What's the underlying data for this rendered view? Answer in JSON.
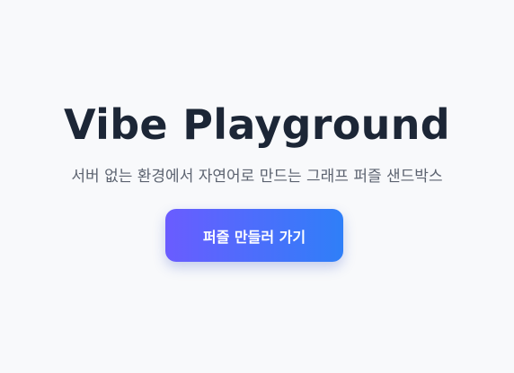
{
  "hero": {
    "title": "Vibe Playground",
    "subtitle": "서버 없는 환경에서 자연어로 만드는 그래프 퍼즐 샌드박스",
    "cta_label": "퍼즐 만들러 가기"
  },
  "colors": {
    "background": "#f8f9fb",
    "title": "#1c2636",
    "subtitle": "#5c6370",
    "cta_gradient_start": "#6a5cff",
    "cta_gradient_end": "#2f7ff8",
    "cta_text": "#ffffff"
  }
}
